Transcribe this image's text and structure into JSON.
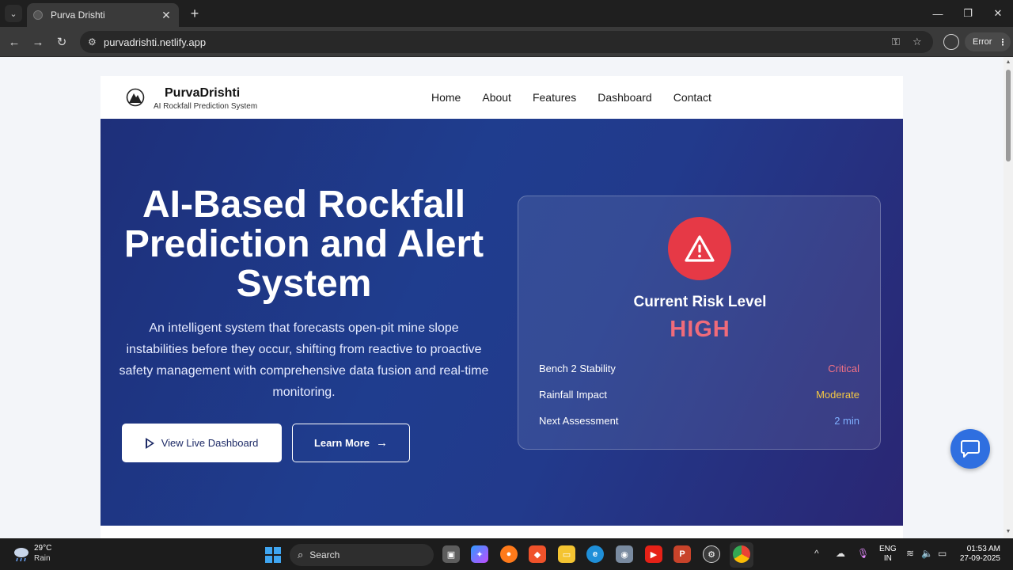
{
  "browser": {
    "tab_title": "Purva Drishti",
    "url": "purvadrishti.netlify.app",
    "error_label": "Error"
  },
  "site": {
    "brand": "PurvaDrishti",
    "tagline": "AI Rockfall Prediction System",
    "nav": [
      "Home",
      "About",
      "Features",
      "Dashboard",
      "Contact"
    ],
    "hero": {
      "title": "AI-Based Rockfall Prediction and Alert System",
      "description": "An intelligent system that forecasts open-pit mine slope instabilities before they occur, shifting from reactive to proactive safety management with comprehensive data fusion and real-time monitoring.",
      "primary_button": "View Live Dashboard",
      "secondary_button": "Learn More"
    },
    "risk_card": {
      "heading": "Current Risk Level",
      "level": "HIGH",
      "rows": [
        {
          "label": "Bench 2 Stability",
          "value": "Critical",
          "color": "#f27184"
        },
        {
          "label": "Rainfall Impact",
          "value": "Moderate",
          "color": "#f5c842"
        },
        {
          "label": "Next Assessment",
          "value": "2 min",
          "color": "#7fb0ff"
        }
      ]
    }
  },
  "taskbar": {
    "weather_temp": "29°C",
    "weather_cond": "Rain",
    "search_placeholder": "Search",
    "lang_line1": "ENG",
    "lang_line2": "IN",
    "time": "01:53 AM",
    "date": "27-09-2025"
  },
  "colors": {
    "hero_gradient_start": "#1e2f7a",
    "hero_gradient_end": "#2a2673",
    "alert_red": "#e63946",
    "chat_blue": "#2f6fe0"
  }
}
